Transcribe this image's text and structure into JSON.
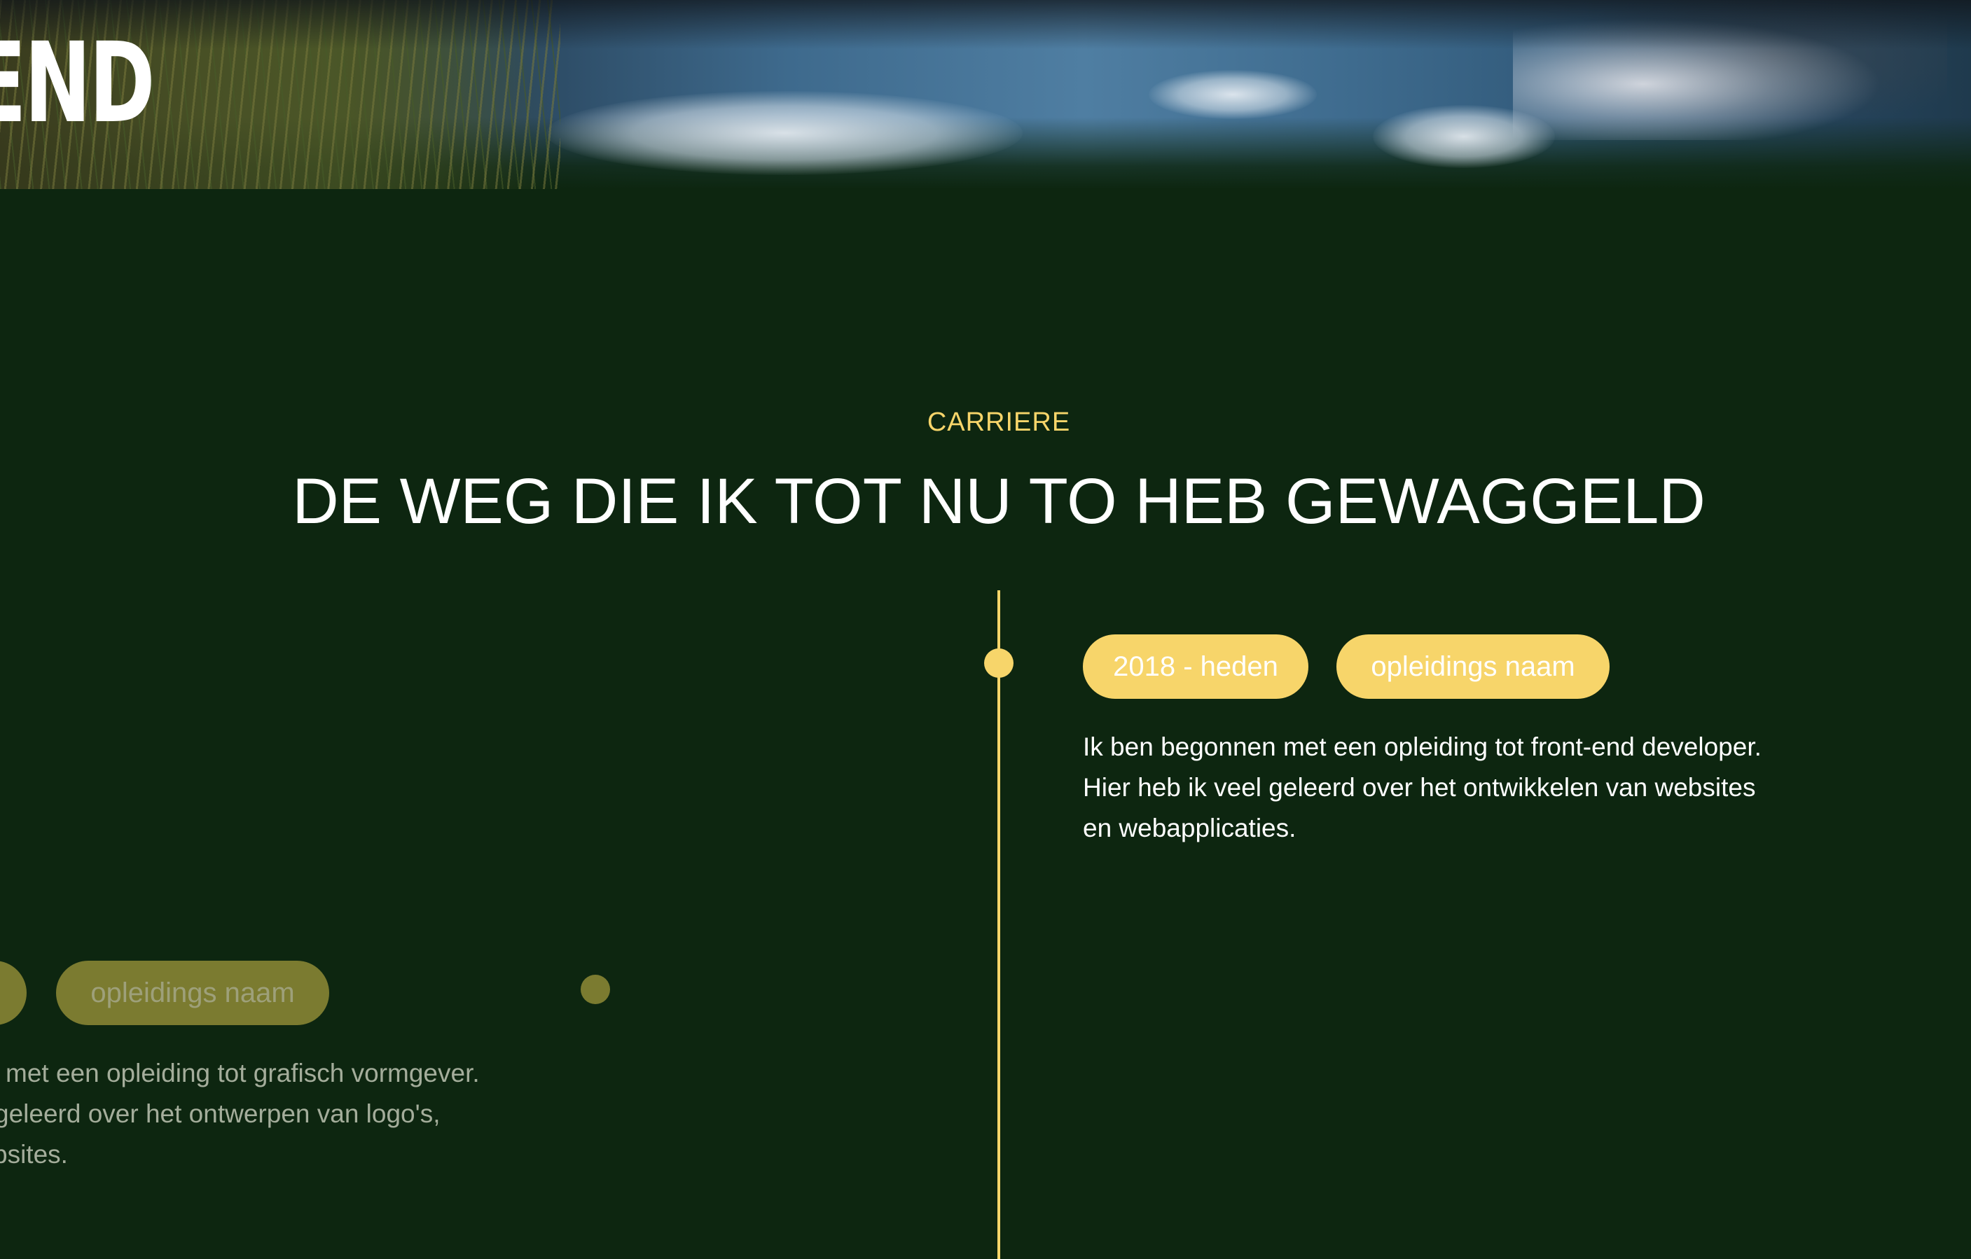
{
  "hero": {
    "title": "END"
  },
  "section": {
    "eyebrow": "CARRIERE",
    "title": "DE WEG DIE IK TOT NU TO HEB GEWAGGELD"
  },
  "colors": {
    "background": "#0d2610",
    "accent": "#f7d56a",
    "accent_faded": "#7b7b30",
    "text": "#ffffff",
    "text_faded": "#a4ad9b"
  },
  "timeline": [
    {
      "period": "2018 - heden",
      "school": "opleidings naam",
      "lines": [
        "Ik ben begonnen met een opleiding tot front-end developer.",
        "Hier heb ik veel geleerd over het ontwikkelen van websites",
        "en webapplicaties."
      ]
    },
    {
      "school": "opleidings naam",
      "lines": [
        "met een opleiding tot grafisch vormgever.",
        "geleerd over het ontwerpen van logo's,",
        "bsites."
      ]
    }
  ]
}
